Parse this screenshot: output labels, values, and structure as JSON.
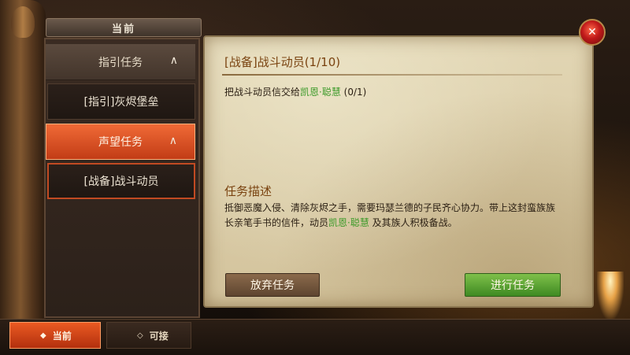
{
  "header": {
    "current_label": "当前"
  },
  "categories": [
    {
      "label": "指引任务",
      "items": [
        "[指引]灰烬堡垒"
      ]
    },
    {
      "label": "声望任务",
      "items": [
        "[战备]战斗动员"
      ]
    }
  ],
  "quest": {
    "title": "[战备]战斗动员(1/10)",
    "objective_prefix": "把战斗动员信交给",
    "objective_npc": "凯恩·聪慧",
    "objective_progress": "(0/1)",
    "description_title": "任务描述",
    "description_part1": "抵御恶魔入侵、清除灰烬之手，需要玛瑟兰德的子民齐心协力。带上这封蛮族族长亲笔手书的信件，动员",
    "description_npc": "凯恩·聪慧",
    "description_part2": " 及其族人积极备战。"
  },
  "buttons": {
    "abandon": "放弃任务",
    "proceed": "进行任务"
  },
  "tabs": {
    "current": "当前",
    "available": "可接"
  },
  "icons": {
    "close": "close-gem-icon",
    "chevron": "chevron-up-icon",
    "tab_marker": "diamond-icon"
  },
  "colors": {
    "accent": "#e0552a",
    "npc_highlight": "#3d9a2a",
    "title": "#7a4310"
  }
}
